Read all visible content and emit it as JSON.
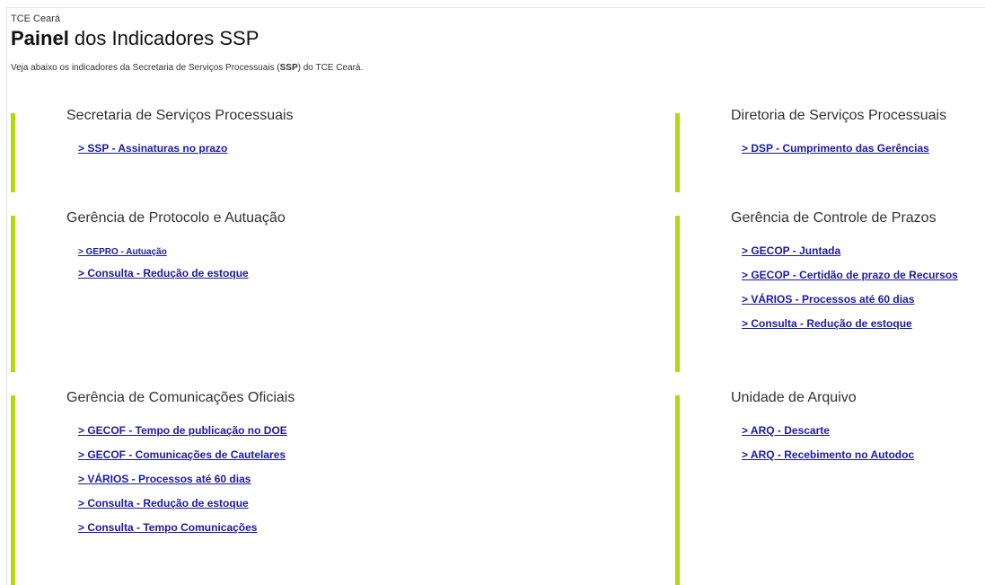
{
  "header": {
    "org": "TCE Ceará",
    "title_bold": "Painel",
    "title_rest": " dos Indicadores SSP",
    "desc_before": "Veja abaixo os indicadores da Secretaria de Serviços Processuais (",
    "desc_bold": "SSP",
    "desc_after": ") do TCE Ceará."
  },
  "sections": [
    {
      "title": "Secretaria de Serviços Processuais",
      "links": [
        "> SSP - Assinaturas no prazo"
      ]
    },
    {
      "title": "Diretoria de Serviços Processuais",
      "links": [
        "> DSP - Cumprimento das Gerências"
      ]
    },
    {
      "title": "Gerência de Protocolo e Autuação",
      "links": [
        "> GEPRO - Autuação",
        "> Consulta - Redução de estoque"
      ]
    },
    {
      "title": "Gerência de Controle de Prazos",
      "links": [
        "> GECOP - Juntada",
        "> GECOP - Certidão de prazo de Recursos",
        "> VÁRIOS - Processos até 60 dias",
        "> Consulta - Redução de estoque"
      ]
    },
    {
      "title": "Gerência de Comunicações Oficiais",
      "links": [
        "> GECOF - Tempo de publicação no DOE",
        "> GECOF - Comunicações de Cautelares",
        "> VÁRIOS - Processos até 60 dias",
        "> Consulta - Redução de estoque",
        "> Consulta - Tempo Comunicações"
      ]
    },
    {
      "title": "Unidade de Arquivo",
      "links": [
        "> ARQ - Descarte",
        "> ARQ - Recebimento no Autodoc"
      ]
    }
  ],
  "colors": {
    "accent_bar": "#b7d60b",
    "link": "#1a1aa6"
  }
}
